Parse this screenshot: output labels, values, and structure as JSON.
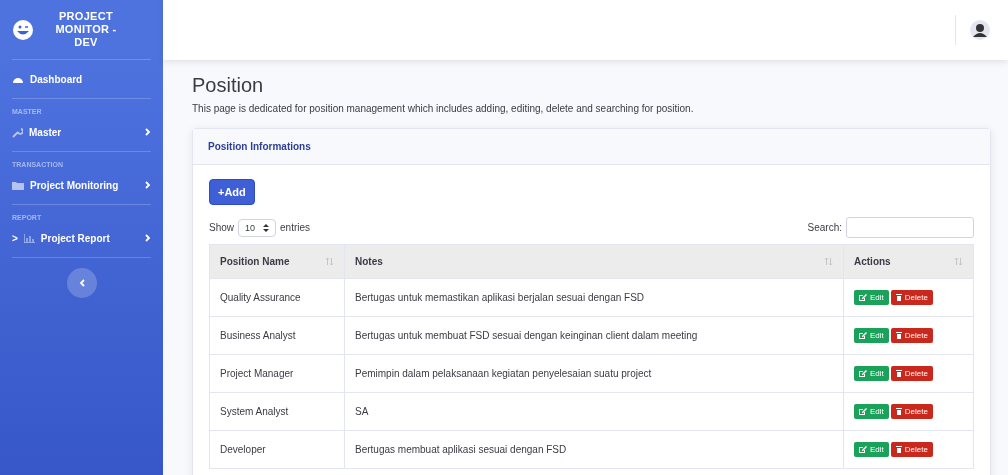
{
  "sidebar": {
    "brand": "PROJECT MONITOR - DEV",
    "sections": [
      {
        "items": [
          {
            "label": "Dashboard"
          }
        ]
      },
      {
        "heading": "MASTER",
        "items": [
          {
            "label": "Master"
          }
        ]
      },
      {
        "heading": "TRANSACTION",
        "items": [
          {
            "label": "Project Monitoring"
          }
        ]
      },
      {
        "heading": "REPORT",
        "items": [
          {
            "label": "Project Report",
            "prefix": ">"
          }
        ]
      }
    ]
  },
  "page": {
    "title": "Position",
    "description": "This page is dedicated for position management which includes adding, editing, delete and searching for position."
  },
  "card": {
    "title": "Position Informations",
    "add_button": "+Add",
    "show_label": "Show",
    "entries_value": "10",
    "entries_label": "entries",
    "search_label": "Search:",
    "columns": [
      "Position Name",
      "Notes",
      "Actions"
    ],
    "rows": [
      {
        "name": "Quality Assurance",
        "notes": "Bertugas untuk memastikan aplikasi berjalan sesuai dengan FSD",
        "edit": "Edit",
        "delete": "Delete"
      },
      {
        "name": "Business Analyst",
        "notes": "Bertugas untuk membuat FSD sesuai dengan keinginan client dalam meeting",
        "edit": "Edit",
        "delete": "Delete"
      },
      {
        "name": "Project Manager",
        "notes": "Pemimpin dalam pelaksanaan kegiatan penyelesaian suatu project",
        "edit": "Edit",
        "delete": "Delete"
      },
      {
        "name": "System Analyst",
        "notes": "SA",
        "edit": "Edit",
        "delete": "Delete"
      },
      {
        "name": "Developer",
        "notes": "Bertugas membuat aplikasi sesuai dengan FSD",
        "edit": "Edit",
        "delete": "Delete"
      }
    ]
  }
}
